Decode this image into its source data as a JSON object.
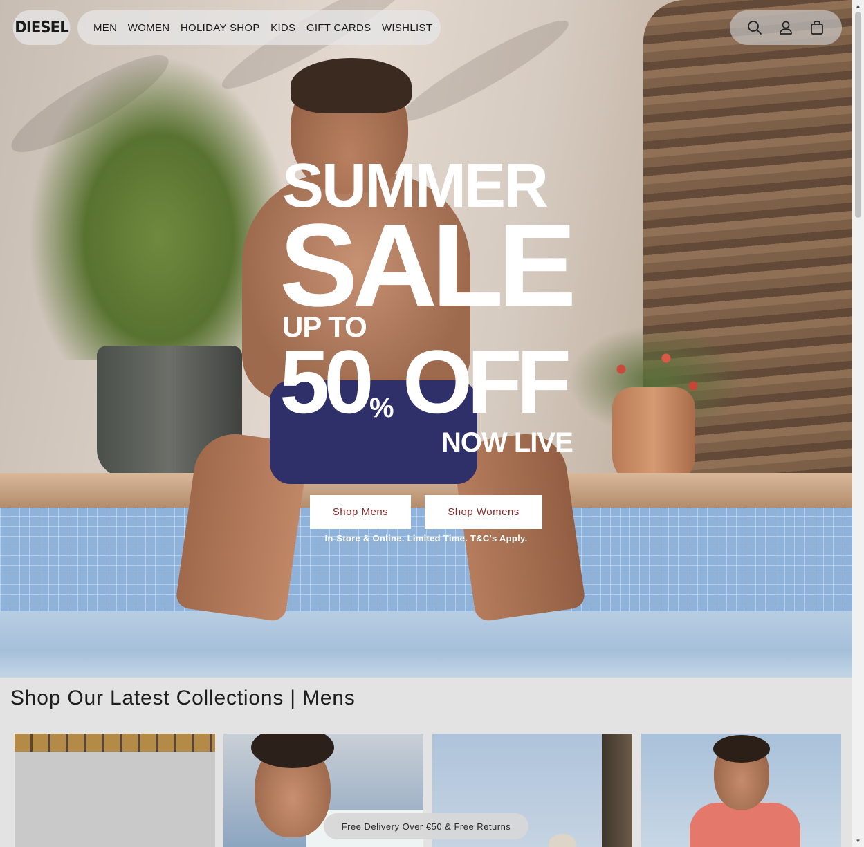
{
  "brand": {
    "logo_text": "DIESEL"
  },
  "nav": {
    "items": [
      "MEN",
      "WOMEN",
      "HOLIDAY SHOP",
      "KIDS",
      "GIFT CARDS",
      "WISHLIST"
    ]
  },
  "header_icons": [
    "search-icon",
    "account-icon",
    "cart-icon"
  ],
  "hero": {
    "line1": "SUMMER",
    "line2": "SALE",
    "line3": "UP TO",
    "discount_number": "50",
    "discount_symbol": "%",
    "discount_word": "OFF",
    "line5": "NOW LIVE",
    "cta_mens": "Shop Mens",
    "cta_womens": "Shop Womens",
    "terms": "In-Store & Online. Limited Time. T&C's Apply."
  },
  "collections": {
    "title": "Shop Our Latest Collections | Mens",
    "cards": 4
  },
  "toast": {
    "text": "Free Delivery Over €50 & Free Returns"
  },
  "colors": {
    "cta_text": "#8a2a2a",
    "pill_background": "#e6e6e6",
    "page_background": "#e3e3e3"
  }
}
